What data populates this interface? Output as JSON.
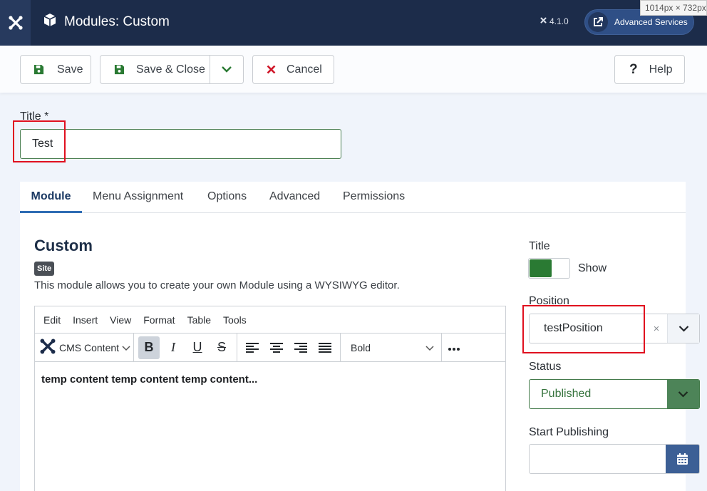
{
  "header": {
    "title": "Modules: Custom",
    "version": "4.1.0",
    "advanced_services": "Advanced Services",
    "dimension_tag": "1014px × 732px"
  },
  "toolbar": {
    "save": "Save",
    "save_close": "Save & Close",
    "cancel": "Cancel",
    "help": "Help"
  },
  "title_field": {
    "label": "Title *",
    "value": "Test"
  },
  "tabs": [
    "Module",
    "Menu Assignment",
    "Options",
    "Advanced",
    "Permissions"
  ],
  "module": {
    "name": "Custom",
    "badge": "Site",
    "description": "This module allows you to create your own Module using a WYSIWYG editor."
  },
  "editor": {
    "menu": [
      "Edit",
      "Insert",
      "View",
      "Format",
      "Table",
      "Tools"
    ],
    "cms_content": "CMS Content",
    "format_select": "Bold",
    "content": "temp content temp content temp content..."
  },
  "side": {
    "title_label": "Title",
    "show_label": "Show",
    "position_label": "Position",
    "position_value": "testPosition",
    "status_label": "Status",
    "status_value": "Published",
    "start_publishing_label": "Start Publishing"
  },
  "colors": {
    "header_bg": "#1c2c4a",
    "success": "#2a7a33",
    "danger": "#e0101f",
    "primary": "#2f6db4"
  }
}
